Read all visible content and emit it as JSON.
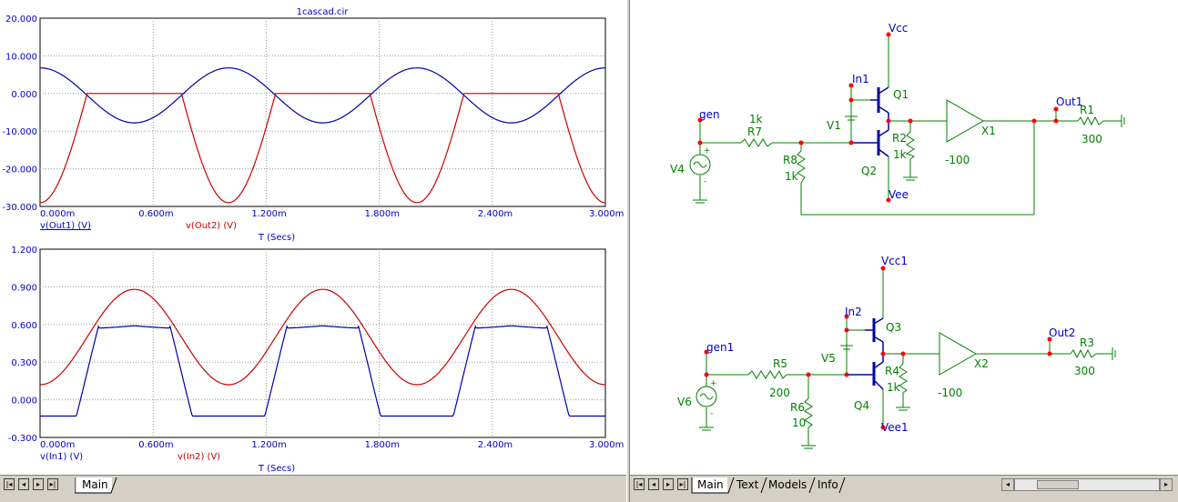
{
  "colors": {
    "red": "#cc0000",
    "blue": "#0000aa",
    "green": "#008000",
    "label_blue": "#0000cc",
    "node_red": "#ff0000",
    "grid": "#999999"
  },
  "plot": {
    "title": "1cascad.cir"
  },
  "chart_data": [
    {
      "type": "line",
      "x_tick_labels": [
        "0.000m",
        "0.600m",
        "1.200m",
        "1.800m",
        "2.400m",
        "3.000m"
      ],
      "y_tick_labels": [
        "20.000",
        "10.000",
        "0.000",
        "-10.000",
        "-20.000",
        "-30.000"
      ],
      "xlim": [
        0,
        3.0
      ],
      "ylim": [
        -30,
        20
      ],
      "xlabel": "T (Secs)",
      "series": [
        {
          "name": "v(Out1) (V)",
          "color": "#0000aa",
          "kind": "sine",
          "offset": -0.5,
          "amplitude": 7.3,
          "period": 1.0,
          "phase": 0.25
        },
        {
          "name": "v(Out2) (V)",
          "color": "#cc0000",
          "kind": "halfwave_neg",
          "offset": 0,
          "amplitude": 29.0,
          "period": 1.0,
          "phase": 0.25
        }
      ]
    },
    {
      "type": "line",
      "x_tick_labels": [
        "0.000m",
        "0.600m",
        "1.200m",
        "1.800m",
        "2.400m",
        "3.000m"
      ],
      "y_tick_labels": [
        "1.200",
        "0.900",
        "0.600",
        "0.300",
        "0.000",
        "-0.300"
      ],
      "xlim": [
        0,
        3.0
      ],
      "ylim": [
        -0.3,
        1.2
      ],
      "xlabel": "T (Secs)",
      "series": [
        {
          "name": "v(In1) (V)",
          "color": "#0000aa",
          "kind": "clipped",
          "offset": 0.22,
          "amplitude": 0.55,
          "period": 1.0,
          "phase": 0.75,
          "top": 0.59,
          "bottom": -0.13
        },
        {
          "name": "v(In2) (V)",
          "color": "#cc0000",
          "kind": "sine",
          "offset": 0.5,
          "amplitude": 0.38,
          "period": 1.0,
          "phase": 0.75
        }
      ]
    }
  ],
  "schematic": {
    "labels": {
      "vcc": "Vcc",
      "in1": "In1",
      "q1": "Q1",
      "v1": "V1",
      "r2": "R2",
      "r2_val": "1k",
      "q2": "Q2",
      "vee": "Vee",
      "gen": "gen",
      "r7_val": "1k",
      "r7": "R7",
      "r8": "R8",
      "r8_val": "1k",
      "v4": "V4",
      "x1": "X1",
      "x1_gain": "-100",
      "out1": "Out1",
      "r1": "R1",
      "r1_val": "300",
      "vcc1": "Vcc1",
      "in2": "In2",
      "q3": "Q3",
      "v5": "V5",
      "r4": "R4",
      "r4_val": "1k",
      "q4": "Q4",
      "vee1": "Vee1",
      "gen1": "gen1",
      "r5": "R5",
      "r5_val": "200",
      "r6": "R6",
      "r6_val": "10",
      "v6": "V6",
      "x2": "X2",
      "x2_gain": "-100",
      "out2": "Out2",
      "r3": "R3",
      "r3_val": "300",
      "plus": "+",
      "minus": "-"
    }
  },
  "left_tabs": [
    {
      "label": "Main",
      "active": true
    }
  ],
  "right_tabs": [
    {
      "label": "Main",
      "active": true
    },
    {
      "label": "Text",
      "active": false
    },
    {
      "label": "Models",
      "active": false
    },
    {
      "label": "Info",
      "active": false
    }
  ],
  "nav_icons": [
    "first-page-icon",
    "prev-page-icon",
    "next-page-icon",
    "last-page-icon"
  ],
  "nav_glyphs": [
    "|◂",
    "◂",
    "▸",
    "▸|"
  ]
}
